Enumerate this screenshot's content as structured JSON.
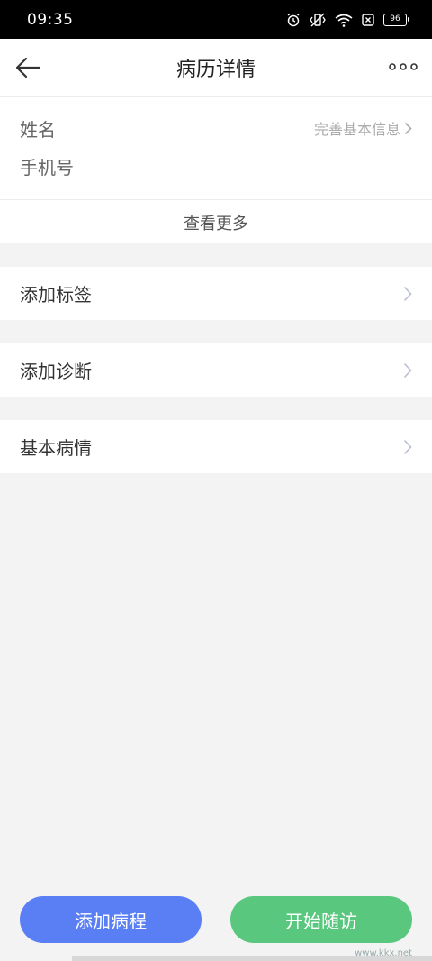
{
  "status_bar": {
    "time": "09:35",
    "battery": "96",
    "icons": [
      "alarm-icon",
      "vibrate-icon",
      "wifi-icon",
      "sim-x-icon",
      "battery-icon"
    ]
  },
  "header": {
    "title": "病历详情",
    "back_icon": "arrow-left-icon",
    "more_icon": "more-dots-icon"
  },
  "patient": {
    "name_label": "姓名",
    "phone_label": "手机号",
    "complete_link": "完善基本信息",
    "view_more": "查看更多"
  },
  "rows": [
    {
      "label": "添加标签"
    },
    {
      "label": "添加诊断"
    },
    {
      "label": "基本病情"
    }
  ],
  "actions": {
    "add_course": "添加病程",
    "start_followup": "开始随访"
  },
  "watermark": "www.kkx.net",
  "colors": {
    "blue_button": "#5a7ff5",
    "green_button": "#5ac77f",
    "background": "#f3f3f3"
  }
}
